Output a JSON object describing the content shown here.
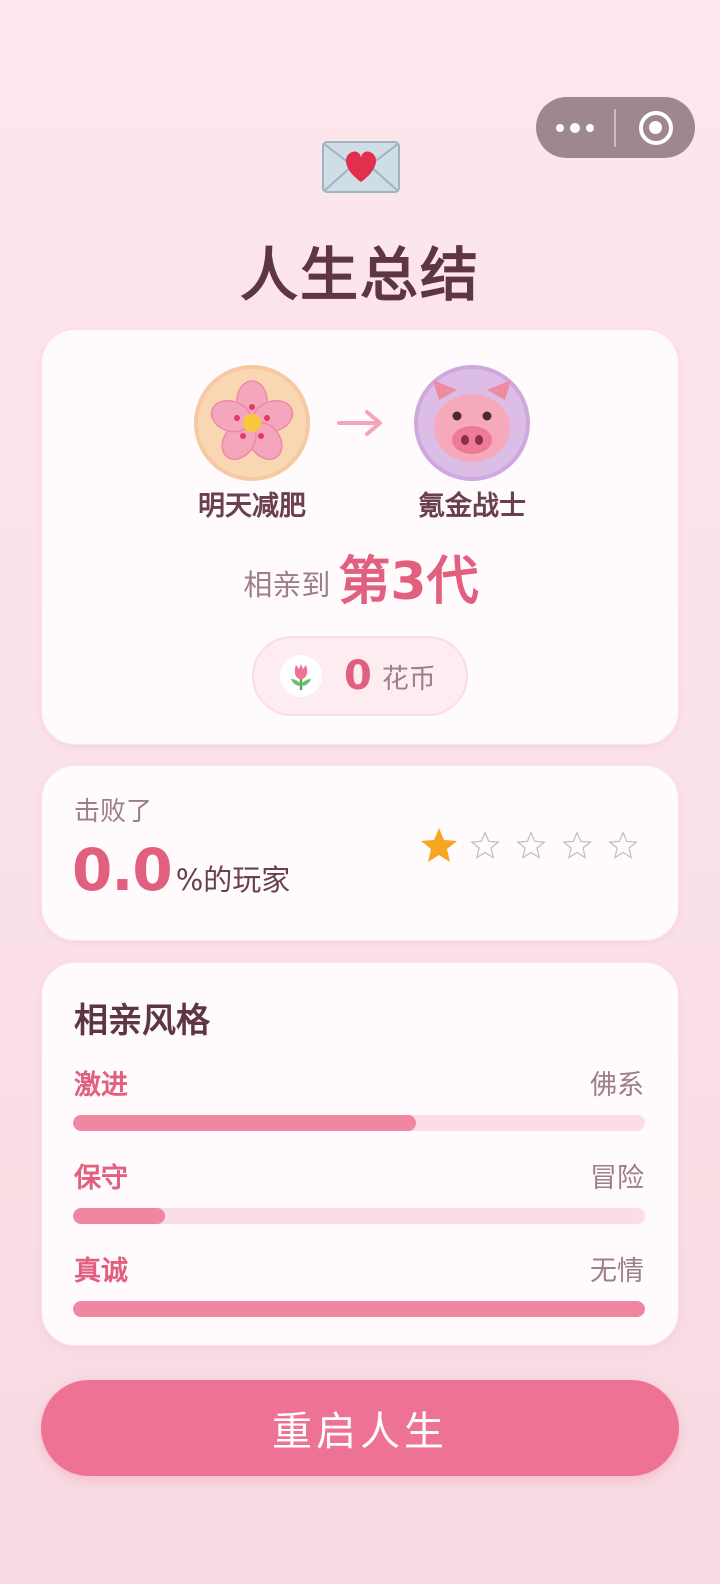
{
  "title": "人生总结",
  "summary": {
    "from_name": "明天减肥",
    "from_icon": "cherry-blossom",
    "to_name": "氪金战士",
    "to_icon": "pig-face",
    "generation_prefix": "相亲到",
    "generation_value": "第3代",
    "coin_value": "0",
    "coin_unit": "花币",
    "coin_icon": "tulip"
  },
  "ranking": {
    "label": "击败了",
    "value": "0.0",
    "suffix": "%的玩家",
    "stars_filled": 1,
    "stars_total": 5
  },
  "style": {
    "title": "相亲风格",
    "traits": [
      {
        "left": "激进",
        "right": "佛系",
        "fill": 0.6
      },
      {
        "left": "保守",
        "right": "冒险",
        "fill": 0.16
      },
      {
        "left": "真诚",
        "right": "无情",
        "fill": 1.0
      }
    ]
  },
  "restart_label": "重启人生",
  "colors": {
    "accent": "#e2607f",
    "button": "#ee7294",
    "bar_fill": "#ef87a2",
    "bar_track": "#fbdde5",
    "star": "#f5a623"
  }
}
